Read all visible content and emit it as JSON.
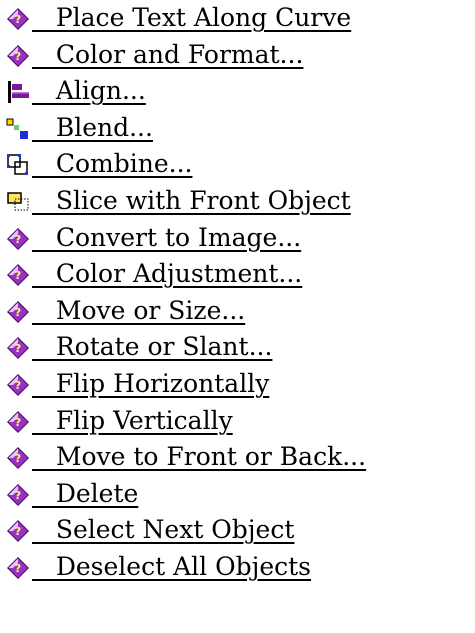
{
  "menu": {
    "items": [
      {
        "label": "   Place Text Along Curve",
        "icon": "diamond-help-icon"
      },
      {
        "label": "   Color and Format...",
        "icon": "diamond-help-icon"
      },
      {
        "label": "   Align...",
        "icon": "align-icon"
      },
      {
        "label": "   Blend...",
        "icon": "blend-icon"
      },
      {
        "label": "   Combine...",
        "icon": "combine-icon"
      },
      {
        "label": "   Slice with Front Object",
        "icon": "slice-icon"
      },
      {
        "label": "   Convert to Image...",
        "icon": "diamond-help-icon"
      },
      {
        "label": "   Color Adjustment...",
        "icon": "diamond-help-icon"
      },
      {
        "label": "   Move or Size...",
        "icon": "diamond-help-icon"
      },
      {
        "label": "   Rotate or Slant...",
        "icon": "diamond-help-icon"
      },
      {
        "label": "   Flip Horizontally",
        "icon": "diamond-help-icon"
      },
      {
        "label": "   Flip Vertically",
        "icon": "diamond-help-icon"
      },
      {
        "label": "   Move to Front or Back...",
        "icon": "diamond-help-icon"
      },
      {
        "label": "   Delete",
        "icon": "diamond-help-icon"
      },
      {
        "label": "   Select Next Object",
        "icon": "diamond-help-icon"
      },
      {
        "label": "   Deselect All Objects",
        "icon": "diamond-help-icon"
      }
    ]
  },
  "colors": {
    "text": "#000000",
    "diamond_fill": "#9b30c8",
    "diamond_light": "#e6c6f5",
    "diamond_dark": "#4b0f6b",
    "align_bar": "#7a1a9a",
    "blend_yellow": "#ffd700",
    "blend_blue": "#1e2fd6",
    "combine_blue": "#1a3bd1",
    "slice_yellow": "#ffe35a"
  }
}
